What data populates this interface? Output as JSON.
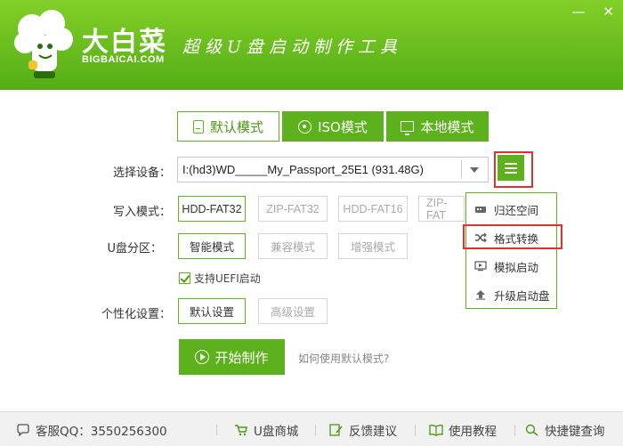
{
  "header": {
    "brand_cn": "大白菜",
    "brand_en": "BIGBAICAI.COM",
    "slogan": "超级U盘启动制作工具",
    "minimize": "—",
    "close": "✕"
  },
  "tabs": [
    {
      "label": "默认模式",
      "icon": "usb-drive-icon"
    },
    {
      "label": "ISO模式",
      "icon": "disc-icon"
    },
    {
      "label": "本地模式",
      "icon": "monitor-icon"
    }
  ],
  "form": {
    "device_label": "选择设备：",
    "device_value": "I:(hd3)WD_____My_Passport_25E1 (931.48G)",
    "write_label": "写入模式：",
    "write_options": [
      "HDD-FAT32",
      "ZIP-FAT32",
      "HDD-FAT16",
      "ZIP-FAT"
    ],
    "partition_label": "U盘分区：",
    "partition_options": [
      "智能模式",
      "兼容模式",
      "增强模式"
    ],
    "uefi_label": "支持UEFI启动",
    "personal_label": "个性化设置：",
    "personal_options": [
      "默认设置",
      "高级设置"
    ]
  },
  "start": {
    "button": "开始制作",
    "help_link": "如何使用默认模式?"
  },
  "dropdown": {
    "items": [
      {
        "label": "归还空间",
        "icon": "disk-icon"
      },
      {
        "label": "格式转换",
        "icon": "shuffle-icon"
      },
      {
        "label": "模拟启动",
        "icon": "screen-play-icon"
      },
      {
        "label": "升级启动盘",
        "icon": "upload-arrow-icon"
      }
    ]
  },
  "footer": {
    "qq": "客服QQ：3550256300",
    "shop": "U盘商城",
    "feedback": "反馈建议",
    "tutorial": "使用教程",
    "shortcut": "快捷键查询"
  },
  "colors": {
    "brand_green": "#5cb11c",
    "highlight_red": "#e03131"
  }
}
